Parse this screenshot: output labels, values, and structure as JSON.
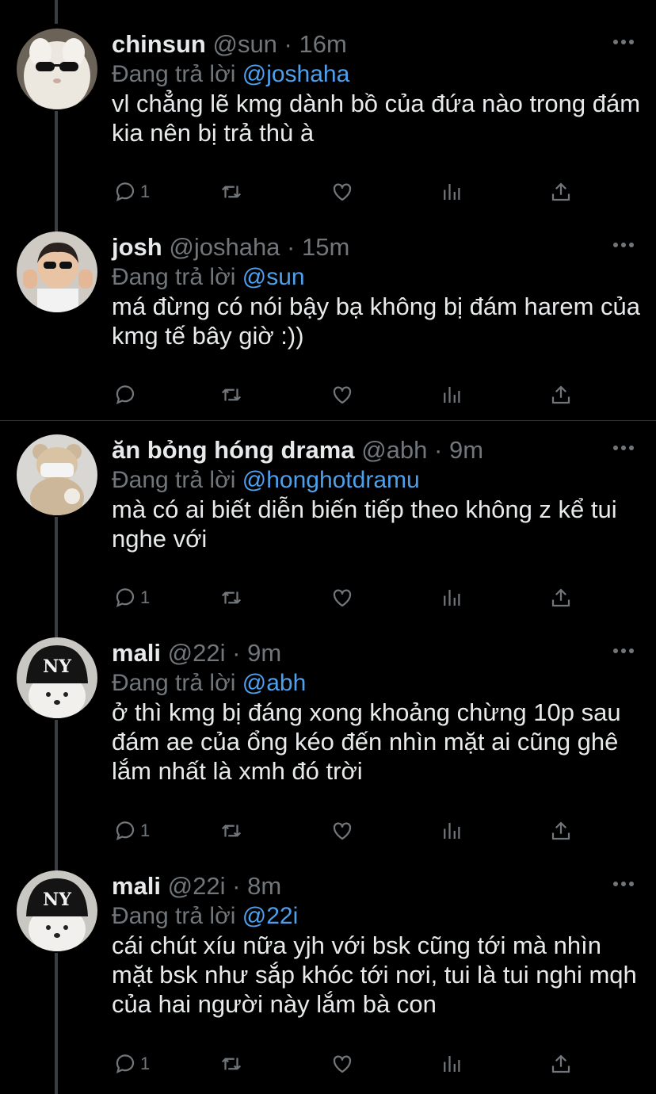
{
  "tweets": [
    {
      "name": "chinsun",
      "handle": "@sun",
      "sep": "·",
      "time": "16m",
      "reply_prefix": "Đang trả lời",
      "reply_to": "@joshaha",
      "text": "vl chẳng lẽ kmg dành bồ của đứa nào trong đám kia nên bị trả thù à",
      "reply_count": "1",
      "avatar": "white-cat-with-sunglasses"
    },
    {
      "name": "josh",
      "handle": "@joshaha",
      "sep": "·",
      "time": "15m",
      "reply_prefix": "Đang trả lời",
      "reply_to": "@sun",
      "text": "má đừng có nói bậy bạ không bị đám harem của kmg tế bây giờ :))",
      "reply_count": "",
      "avatar": "baby-with-sunglasses-thumbs-up"
    },
    {
      "name": "ăn bỏng hóng drama",
      "handle": "@abh",
      "sep": "·",
      "time": "9m",
      "reply_prefix": "Đang trả lời",
      "reply_to": "@honghotdramu",
      "text": "mà có ai biết diễn biến tiếp theo không z kể tui nghe với",
      "reply_count": "1",
      "avatar": "teddy-bear-with-mask"
    },
    {
      "name": "mali",
      "handle": "@22i",
      "sep": "·",
      "time": "9m",
      "reply_prefix": "Đang trả lời",
      "reply_to": "@abh",
      "text": "ở thì kmg bị đáng xong khoảng chừng 10p sau đám ae của ổng kéo đến nhìn mặt ai cũng ghê lắm nhất là xmh đó trời",
      "reply_count": "1",
      "avatar": "dog-with-ny-beanie"
    },
    {
      "name": "mali",
      "handle": "@22i",
      "sep": "·",
      "time": "8m",
      "reply_prefix": "Đang trả lời",
      "reply_to": "@22i",
      "text": "cái chút xíu nữa yjh với bsk cũng tới mà nhìn mặt bsk như sắp khóc tới nơi, tui là tui nghi mqh của hai người này lắm bà con",
      "reply_count": "1",
      "avatar": "dog-with-ny-beanie"
    }
  ],
  "colors": {
    "background": "#000000",
    "text": "#e7e9ea",
    "muted": "#71767b",
    "mention": "#4ea0ec",
    "divider": "#2f3336"
  },
  "icons": [
    "reply-icon",
    "retweet-icon",
    "like-icon",
    "analytics-icon",
    "share-icon",
    "more-icon"
  ]
}
